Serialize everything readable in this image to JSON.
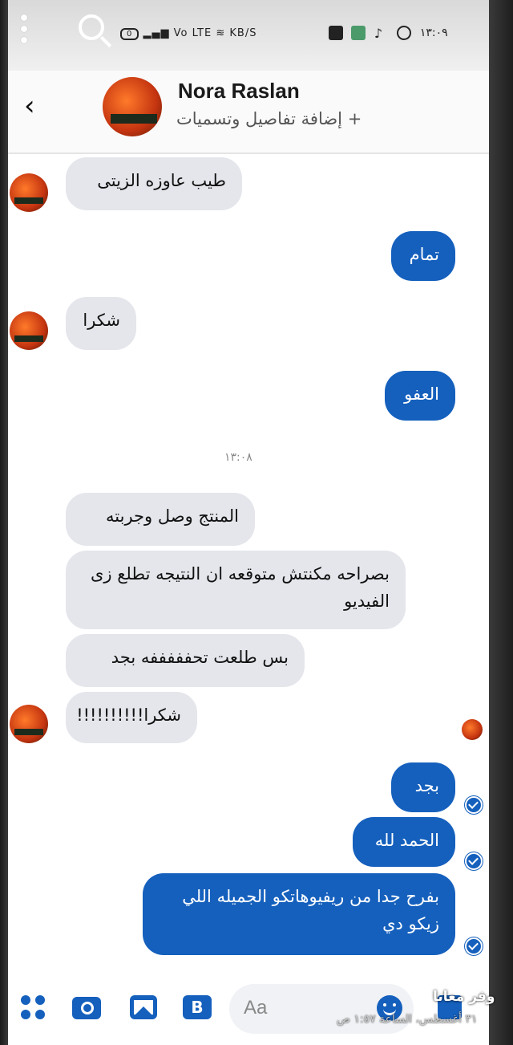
{
  "status_bar": {
    "left_indicators": "KB/S",
    "clock": "١٣:٠٩"
  },
  "header": {
    "contact_name": "Nora Raslan",
    "subtitle": "+ إضافة تفاصيل وتسميات"
  },
  "messages": [
    {
      "direction": "in",
      "text": "طيب عاوزه الزيتى"
    },
    {
      "direction": "out",
      "text": "تمام"
    },
    {
      "direction": "in",
      "text": "شكرا"
    },
    {
      "direction": "out",
      "text": "العفو"
    },
    {
      "direction": "in",
      "text": "المنتج وصل وجربته"
    },
    {
      "direction": "in",
      "text": "بصراحه مكنتش متوقعه ان النتيجه تطلع زى الفيديو"
    },
    {
      "direction": "in",
      "text": "بس طلعت تحفففففه بجد"
    },
    {
      "direction": "in",
      "text": "شكرا!!!!!!!!!!"
    },
    {
      "direction": "out",
      "text": "بجد"
    },
    {
      "direction": "out",
      "text": "الحمد لله"
    },
    {
      "direction": "out",
      "text": "بفرح جدا من ريفيوهاتكو الجميله اللي زيكو دي"
    }
  ],
  "timestamp_divider": "١٣:٠٨",
  "composer": {
    "placeholder": "Aa"
  },
  "watermark": {
    "brand": "وفر معانا",
    "date": "٣١ أغسطس، الساعة ١:٥٧ ص"
  },
  "colors": {
    "accent": "#1560bd",
    "incoming_bubble": "#e4e6eb"
  }
}
